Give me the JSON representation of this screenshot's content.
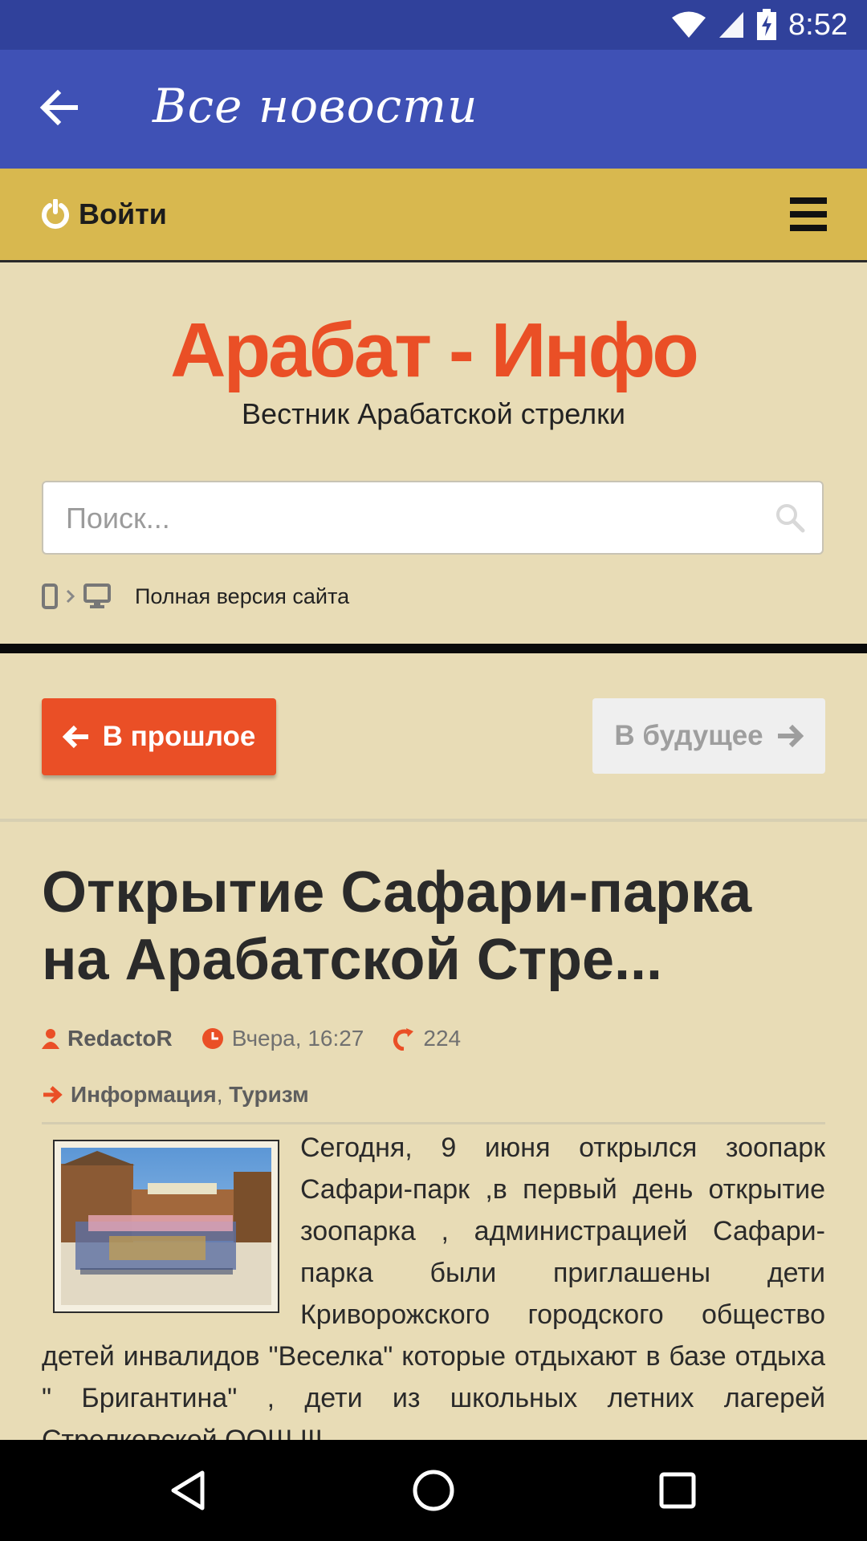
{
  "status_bar": {
    "time": "8:52"
  },
  "app_bar": {
    "title": "Все новости"
  },
  "login_bar": {
    "login_label": "Войти"
  },
  "header": {
    "site_title": "Арабат - Инфо",
    "tagline": "Вестник Арабатской стрелки",
    "search_placeholder": "Поиск...",
    "full_version_label": "Полная версия сайта"
  },
  "nav_buttons": {
    "prev_label": "В прошлое",
    "next_label": "В будущее"
  },
  "article": {
    "headline": "Открытие Сафари-парка на Арабатской Стре...",
    "author": "RedactoR",
    "date": "Вчера, 16:27",
    "views": "224",
    "category_1": "Информация",
    "category_separator": ",",
    "category_2": "Туризм",
    "body": "Сегодня, 9 июня открылся зоопарк Сафари-парк ,в первый день открытие зоопарка , администрацией Сафари-парка были приглашены дети Криворожского городского общество детей инвалидов \"Веселка\" которые отдыхают в базе отдыха \" Бригантина\" , дети из школьных летних лагерей Стрелковской ООШ ІІІ"
  },
  "colors": {
    "status_bar": "#30419b",
    "app_bar": "#3f51b5",
    "login_bar": "#d8b84f",
    "page_bg": "#e8dcb6",
    "accent": "#ea4f26"
  }
}
